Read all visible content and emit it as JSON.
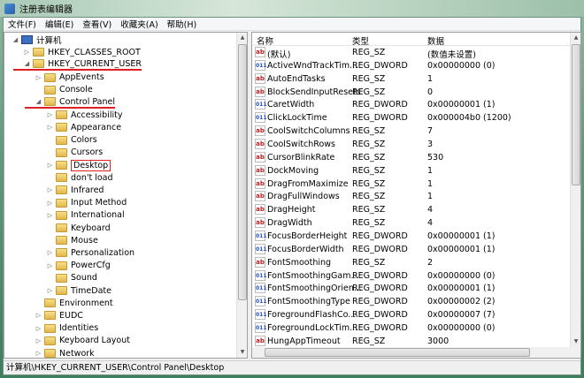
{
  "window": {
    "title": "注册表编辑器"
  },
  "menu": [
    "文件(F)",
    "编辑(E)",
    "查看(V)",
    "收藏夹(A)",
    "帮助(H)"
  ],
  "tree": [
    {
      "label": "计算机",
      "level": 0,
      "exp": "open",
      "pc": true
    },
    {
      "label": "HKEY_CLASSES_ROOT",
      "level": 1,
      "exp": "closed"
    },
    {
      "label": "HKEY_CURRENT_USER",
      "level": 1,
      "exp": "open",
      "underline": true
    },
    {
      "label": "AppEvents",
      "level": 2,
      "exp": "closed"
    },
    {
      "label": "Console",
      "level": 2,
      "exp": ""
    },
    {
      "label": "Control Panel",
      "level": 2,
      "exp": "open",
      "underline": true
    },
    {
      "label": "Accessibility",
      "level": 3,
      "exp": "closed"
    },
    {
      "label": "Appearance",
      "level": 3,
      "exp": "closed"
    },
    {
      "label": "Colors",
      "level": 3,
      "exp": ""
    },
    {
      "label": "Cursors",
      "level": 3,
      "exp": ""
    },
    {
      "label": "Desktop",
      "level": 3,
      "exp": "closed",
      "selected": true
    },
    {
      "label": "don't load",
      "level": 3,
      "exp": ""
    },
    {
      "label": "Infrared",
      "level": 3,
      "exp": "closed"
    },
    {
      "label": "Input Method",
      "level": 3,
      "exp": "closed"
    },
    {
      "label": "International",
      "level": 3,
      "exp": "closed"
    },
    {
      "label": "Keyboard",
      "level": 3,
      "exp": ""
    },
    {
      "label": "Mouse",
      "level": 3,
      "exp": ""
    },
    {
      "label": "Personalization",
      "level": 3,
      "exp": "closed"
    },
    {
      "label": "PowerCfg",
      "level": 3,
      "exp": "closed"
    },
    {
      "label": "Sound",
      "level": 3,
      "exp": ""
    },
    {
      "label": "TimeDate",
      "level": 3,
      "exp": "closed"
    },
    {
      "label": "Environment",
      "level": 2,
      "exp": ""
    },
    {
      "label": "EUDC",
      "level": 2,
      "exp": "closed"
    },
    {
      "label": "Identities",
      "level": 2,
      "exp": "closed"
    },
    {
      "label": "Keyboard Layout",
      "level": 2,
      "exp": "closed"
    },
    {
      "label": "Network",
      "level": 2,
      "exp": "closed"
    }
  ],
  "columns": {
    "name": "名称",
    "type": "类型",
    "data": "数据"
  },
  "values": [
    [
      "(默认)",
      "REG_SZ",
      "(数值未设置)"
    ],
    [
      "ActiveWndTrackTim...",
      "REG_DWORD",
      "0x00000000 (0)"
    ],
    [
      "AutoEndTasks",
      "REG_SZ",
      "1"
    ],
    [
      "BlockSendInputResets",
      "REG_SZ",
      "0"
    ],
    [
      "CaretWidth",
      "REG_DWORD",
      "0x00000001 (1)"
    ],
    [
      "ClickLockTime",
      "REG_DWORD",
      "0x000004b0 (1200)"
    ],
    [
      "CoolSwitchColumns",
      "REG_SZ",
      "7"
    ],
    [
      "CoolSwitchRows",
      "REG_SZ",
      "3"
    ],
    [
      "CursorBlinkRate",
      "REG_SZ",
      "530"
    ],
    [
      "DockMoving",
      "REG_SZ",
      "1"
    ],
    [
      "DragFromMaximize",
      "REG_SZ",
      "1"
    ],
    [
      "DragFullWindows",
      "REG_SZ",
      "1"
    ],
    [
      "DragHeight",
      "REG_SZ",
      "4"
    ],
    [
      "DragWidth",
      "REG_SZ",
      "4"
    ],
    [
      "FocusBorderHeight",
      "REG_DWORD",
      "0x00000001 (1)"
    ],
    [
      "FocusBorderWidth",
      "REG_DWORD",
      "0x00000001 (1)"
    ],
    [
      "FontSmoothing",
      "REG_SZ",
      "2"
    ],
    [
      "FontSmoothingGam...",
      "REG_DWORD",
      "0x00000000 (0)"
    ],
    [
      "FontSmoothingOrien...",
      "REG_DWORD",
      "0x00000001 (1)"
    ],
    [
      "FontSmoothingType",
      "REG_DWORD",
      "0x00000002 (2)"
    ],
    [
      "ForegroundFlashCo...",
      "REG_DWORD",
      "0x00000007 (7)"
    ],
    [
      "ForegroundLockTim...",
      "REG_DWORD",
      "0x00000000 (0)"
    ],
    [
      "HungAppTimeout",
      "REG_SZ",
      "3000"
    ]
  ],
  "icons": {
    "sz": "ab",
    "dword": "011"
  },
  "status": "计算机\\HKEY_CURRENT_USER\\Control Panel\\Desktop",
  "accent": "#e02020"
}
